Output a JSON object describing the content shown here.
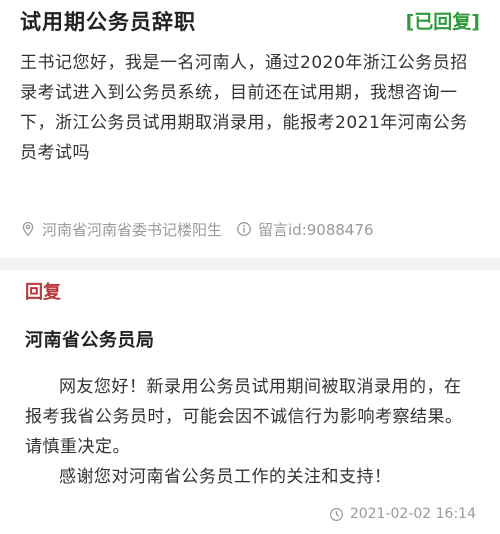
{
  "question": {
    "title": "试用期公务员辞职",
    "status": "[已回复]",
    "body": "王书记您好，我是一名河南人，通过2020年浙江公务员招录考试进入到公务员系统，目前还在试用期，我想咨询一下，浙江公务员试用期取消录用，能报考2021年河南公务员考试吗",
    "location": "河南省河南省委书记楼阳生",
    "message_id": "留言id:9088476",
    "icons": {
      "location": "location-pin-icon",
      "info": "info-circle-icon"
    }
  },
  "reply": {
    "label": "回复",
    "organization": "河南省公务员局",
    "paragraphs": [
      "网友您好！新录用公务员试用期间被取消录用的，在报考我省公务员时，可能会因不诚信行为影响考察结果。请慎重决定。",
      "感谢您对河南省公务员工作的关注和支持！"
    ],
    "timestamp": "2021-02-02 16:14",
    "icons": {
      "time": "clock-icon"
    }
  },
  "colors": {
    "status_green": "#2f9a3c",
    "reply_red": "#b8373b",
    "meta_gray": "#9a9a9a",
    "divider": "#f2f2f2"
  }
}
